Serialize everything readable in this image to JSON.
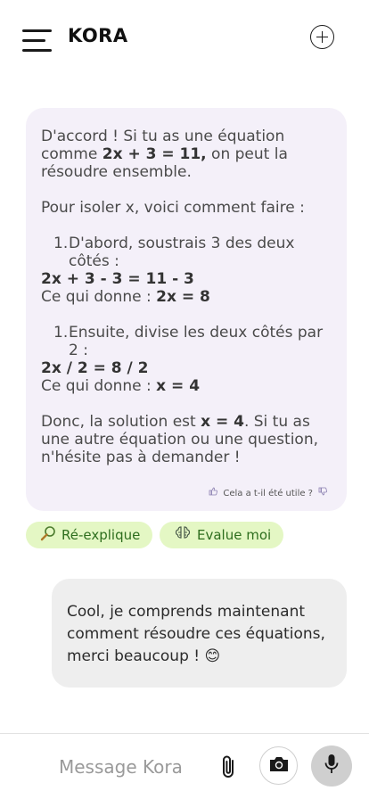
{
  "header": {
    "title": "KORA",
    "menu_icon": "hamburger-menu-icon",
    "new_chat_icon": "plus-circle-icon"
  },
  "bot_message": {
    "intro_1": "D'accord ! Si tu as une équation comme ",
    "intro_eq": "2x + 3 = 11,",
    "intro_2": " on peut la résoudre ensemble.",
    "method": "Pour isoler x, voici comment faire :",
    "step1_num": "1.",
    "step1_text": "D'abord, soustrais 3 des deux côtés :",
    "step1_eq": "2x + 3 - 3 = 11 - 3",
    "step1_result_label": "Ce qui donne : ",
    "step1_result": "2x = 8",
    "step2_num": "1.",
    "step2_text": "Ensuite, divise les deux côtés par 2 :",
    "step2_eq": "2x / 2 = 8 / 2",
    "step2_result_label": "Ce qui donne : ",
    "step2_result": "x = 4",
    "conclusion_1": "Donc, la solution est ",
    "conclusion_eq": "x = 4",
    "conclusion_2": ". Si tu as une autre équation ou une question, n'hésite pas à demander !",
    "feedback_text": "Cela a t-il été utile ?"
  },
  "actions": {
    "reexplain_label": "Ré-explique",
    "reexplain_icon": "magnifier-icon",
    "evaluate_label": "Evalue moi",
    "evaluate_icon": "brain-icon"
  },
  "user_message": {
    "text": "Cool, je comprends maintenant comment résoudre ces équations, merci beaucoup ! 😊"
  },
  "input_bar": {
    "placeholder": "Message Kora",
    "attach_icon": "paperclip-icon",
    "camera_icon": "camera-icon",
    "mic_icon": "microphone-icon"
  },
  "colors": {
    "bot_bubble": "#f4f0f9",
    "user_bubble": "#eeeeee",
    "chip_bg": "#e4f7c4",
    "chip_text": "#2e6e1e",
    "mic_bg": "#cfcfcf"
  }
}
